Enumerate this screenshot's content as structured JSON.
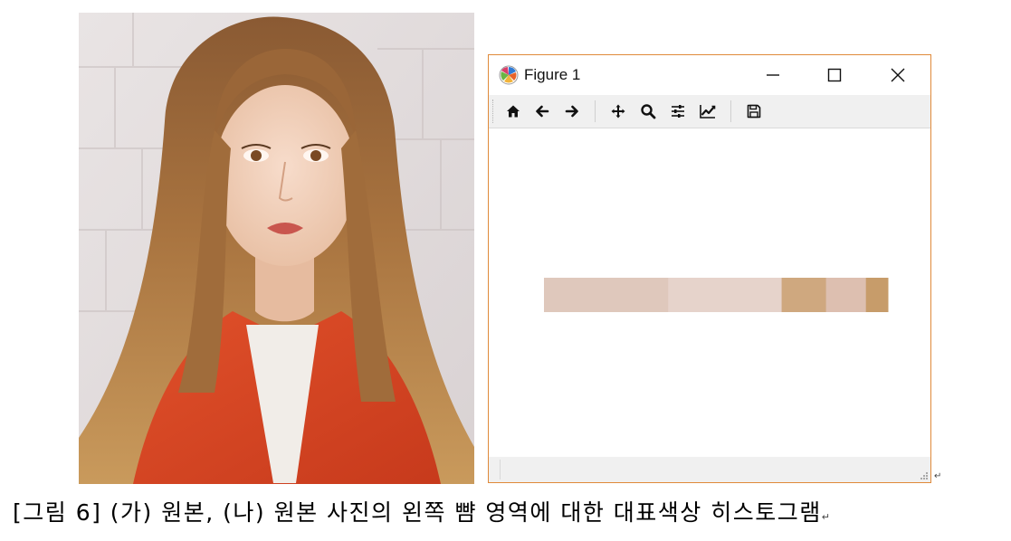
{
  "window": {
    "title": "Figure 1",
    "border_color": "#e08a3a"
  },
  "titlebar_buttons": [
    "minimize-icon",
    "maximize-icon",
    "close-icon"
  ],
  "toolbar": {
    "tools": [
      "home-icon",
      "back-arrow-icon",
      "forward-arrow-icon",
      "pan-move-icon",
      "zoom-icon",
      "configure-subplots-icon",
      "edit-axes-icon",
      "save-icon"
    ]
  },
  "chart_data": {
    "type": "bar",
    "orientation": "horizontal-stacked",
    "segments": [
      {
        "fraction": 0.361,
        "color": "#dfc8bc"
      },
      {
        "fraction": 0.33,
        "color": "#e6d3cb"
      },
      {
        "fraction": 0.129,
        "color": "#cfa87f"
      },
      {
        "fraction": 0.116,
        "color": "#ddbfb0"
      },
      {
        "fraction": 0.064,
        "color": "#c79c6a"
      }
    ],
    "axes": false,
    "grid": false
  },
  "caption": {
    "text": "[그림 6] (가) 원본, (나) 원본 사진의 왼쪽 뺨 영역에 대한 대표색상 히스토그램",
    "return_mark": "↵"
  },
  "status_return_mark": "↵"
}
